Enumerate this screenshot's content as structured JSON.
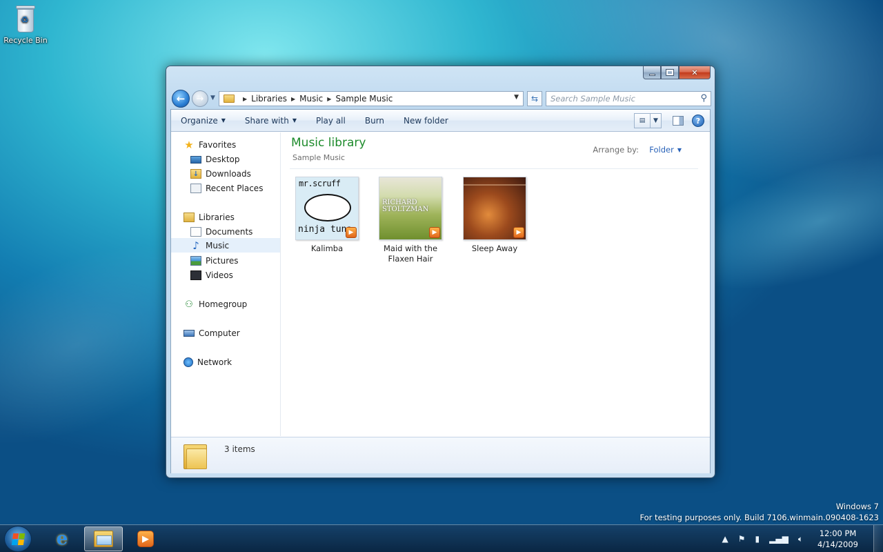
{
  "desktop": {
    "icons": [
      {
        "label": "Recycle Bin",
        "icon": "recycle-bin-icon"
      }
    ]
  },
  "window": {
    "address": {
      "crumbs": [
        "Libraries",
        "Music",
        "Sample Music"
      ],
      "search_placeholder": "Search Sample Music"
    },
    "toolbar": {
      "organize": "Organize",
      "share_with": "Share with",
      "play_all": "Play all",
      "burn": "Burn",
      "new_folder": "New folder"
    },
    "nav": {
      "favorites": "Favorites",
      "desktop": "Desktop",
      "downloads": "Downloads",
      "recent_places": "Recent Places",
      "libraries": "Libraries",
      "documents": "Documents",
      "music": "Music",
      "pictures": "Pictures",
      "videos": "Videos",
      "homegroup": "Homegroup",
      "computer": "Computer",
      "network": "Network",
      "selected": "Music"
    },
    "content": {
      "title": "Music library",
      "subtitle": "Sample Music",
      "arrange_label": "Arrange by:",
      "arrange_value": "Folder",
      "items": [
        {
          "name": "Kalimba",
          "art_text_top": "mr.scruff",
          "art_text_bottom": "ninja tuna"
        },
        {
          "name_line1": "Maid with the",
          "name_line2": "Flaxen Hair",
          "art_text": "RICHARD STOLTZMAN"
        },
        {
          "name": "Sleep Away"
        }
      ]
    },
    "details": {
      "count": "3 items"
    }
  },
  "watermark": {
    "line1": "Windows 7",
    "line2": "For testing purposes only. Build 7106.winmain.090408-1623"
  },
  "taskbar": {
    "clock_time": "12:00 PM",
    "clock_date": "4/14/2009",
    "pinned": [
      "internet-explorer-icon",
      "windows-explorer-icon",
      "windows-media-player-icon"
    ],
    "active": "windows-explorer-icon"
  },
  "colors": {
    "library_title": "#1e8b2c",
    "arrange_link": "#2962b8",
    "close_button": "#c2391a"
  }
}
